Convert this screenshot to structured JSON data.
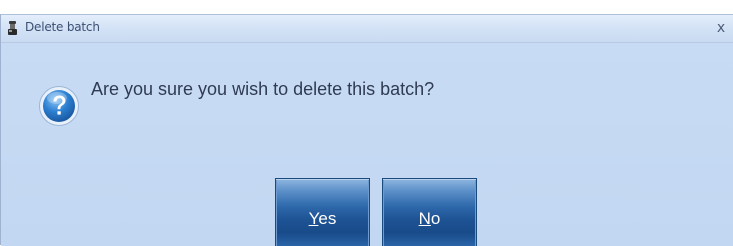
{
  "dialog": {
    "title": "Delete batch",
    "close_glyph": "x",
    "message": "Are you sure you wish to delete this batch?",
    "icon": "question-icon",
    "buttons": {
      "yes": {
        "accel": "Y",
        "rest": "es"
      },
      "no": {
        "accel": "N",
        "rest": "o"
      }
    }
  },
  "colors": {
    "dialog_background": "#c3d8f2",
    "button_dark": "#184b89",
    "button_light": "#8fb6e0",
    "question_icon": "#2c7fd1"
  }
}
